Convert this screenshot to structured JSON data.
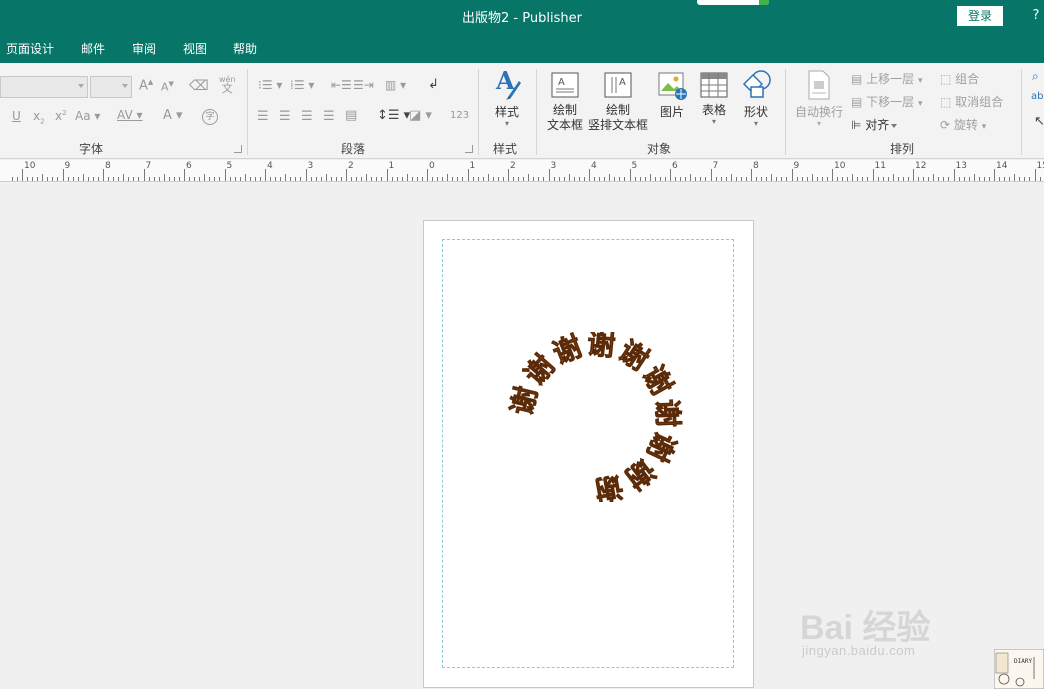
{
  "titlebar": {
    "title": "出版物2  -  Publisher",
    "login_label": "登录",
    "help_label": "?"
  },
  "menu": {
    "tabs": [
      "页面设计",
      "邮件",
      "审阅",
      "视图",
      "帮助"
    ]
  },
  "ribbon": {
    "groups": {
      "font": "字体",
      "paragraph": "段落",
      "styles": "样式",
      "objects": "对象",
      "arrange": "排列"
    },
    "font": {
      "grow": "A",
      "shrink": "A",
      "phonetic": "wén",
      "phonetic_char": "文",
      "underline": "U",
      "subscript": "x",
      "superscript": "x",
      "case": "Aa",
      "spacing": "AV",
      "font_color": "A",
      "enclose": "字"
    },
    "paragraph": {
      "numbering": "123"
    },
    "styles_button": "样式",
    "objects": {
      "draw_textbox_l1": "绘制",
      "draw_textbox_l2": "文本框",
      "draw_vtextbox_l1": "绘制",
      "draw_vtextbox_l2": "竖排文本框",
      "picture": "图片",
      "table": "表格",
      "shapes": "形状"
    },
    "arrange": {
      "wrap_text": "自动换行",
      "bring_forward": "上移一层",
      "send_backward": "下移一层",
      "align": "对齐",
      "group": "组合",
      "ungroup": "取消组合",
      "rotate": "旋转"
    },
    "edit_partial": "ab"
  },
  "ruler": {
    "labels": [
      "10",
      "9",
      "8",
      "7",
      "6",
      "5",
      "4",
      "3",
      "2",
      "1",
      "0",
      "1",
      "2",
      "3",
      "4",
      "5",
      "6",
      "7",
      "8",
      "9",
      "10",
      "11",
      "12",
      "13",
      "14",
      "15"
    ]
  },
  "document": {
    "wordart_text": "谢谢谢谢谢谢谢谢谢谢",
    "wordart_color": "#c8661c"
  },
  "watermark": {
    "brand": "Bai  经验",
    "url": "jingyan.baidu.com",
    "diary": "DIARY"
  },
  "colors": {
    "accent": "#077568",
    "margin_guide": "#8ec9d6"
  }
}
